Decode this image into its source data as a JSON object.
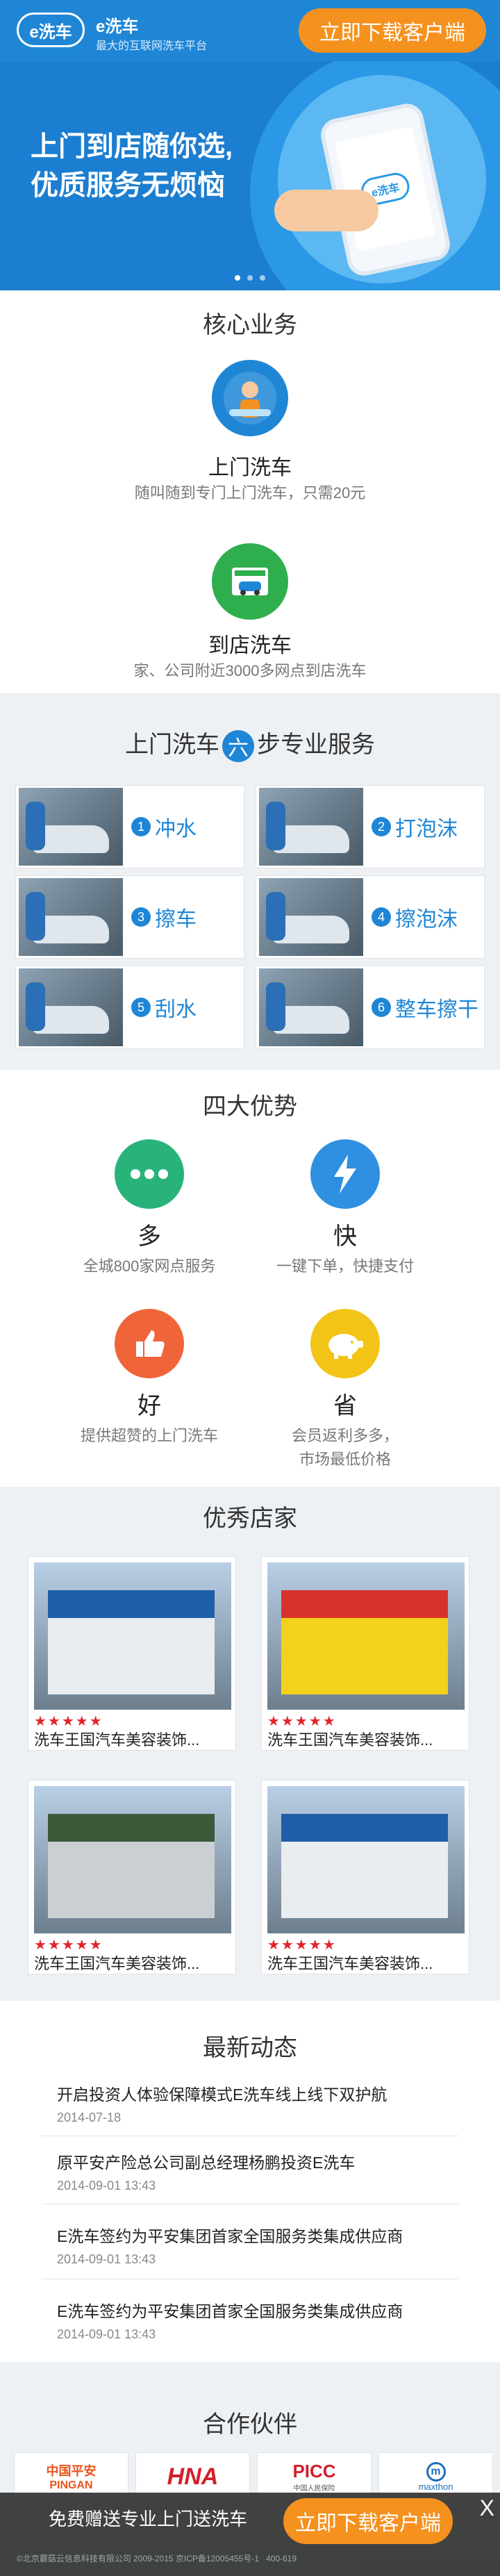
{
  "header": {
    "logo_text": "e洗车",
    "brand": "e洗车",
    "tagline": "最大的互联网洗车平台",
    "download": "立即下载客户端"
  },
  "banner": {
    "line1": "上门到店随你选,",
    "line2": "优质服务无烦恼",
    "phone_logo": "e洗车"
  },
  "core": {
    "title": "核心业务",
    "items": [
      {
        "name": "上门洗车",
        "desc": "随叫随到专门上门洗车，只需20元"
      },
      {
        "name": "到店洗车",
        "desc": "家、公司附近3000多网点到店洗车"
      }
    ]
  },
  "steps": {
    "title_pre": "上门洗车",
    "title_num": "六",
    "title_post": "步专业服务",
    "items": [
      {
        "num": "1",
        "label": "冲水"
      },
      {
        "num": "2",
        "label": "打泡沫"
      },
      {
        "num": "3",
        "label": "擦车"
      },
      {
        "num": "4",
        "label": "擦泡沫"
      },
      {
        "num": "5",
        "label": "刮水"
      },
      {
        "num": "6",
        "label": "整车擦干"
      }
    ]
  },
  "advantages": {
    "title": "四大优势",
    "items": [
      {
        "name": "多",
        "desc1": "全城800家网点服务",
        "desc2": "",
        "color": "#28b37a"
      },
      {
        "name": "快",
        "desc1": "一键下单，快捷支付",
        "desc2": "",
        "color": "#2f8fe0"
      },
      {
        "name": "好",
        "desc1": "提供超赞的上门洗车",
        "desc2": "",
        "color": "#f0643a"
      },
      {
        "name": "省",
        "desc1": "会员返利多多，",
        "desc2": "市场最低价格",
        "color": "#f2c418"
      }
    ]
  },
  "stores": {
    "title": "优秀店家",
    "items": [
      {
        "name": "洗车王国汽车美容装饰...",
        "stars": "★★★★★"
      },
      {
        "name": "洗车王国汽车美容装饰...",
        "stars": "★★★★★"
      },
      {
        "name": "洗车王国汽车美容装饰...",
        "stars": "★★★★★"
      },
      {
        "name": "洗车王国汽车美容装饰...",
        "stars": "★★★★★"
      }
    ]
  },
  "news": {
    "title": "最新动态",
    "items": [
      {
        "title": "开启投资人体验保障模式E洗车线上线下双护航",
        "date": "2014-07-18"
      },
      {
        "title": "原平安产险总公司副总经理杨鹏投资E洗车",
        "date": "2014-09-01 13:43"
      },
      {
        "title": "E洗车签约为平安集团首家全国服务类集成供应商",
        "date": "2014-09-01 13:43"
      },
      {
        "title": "E洗车签约为平安集团首家全国服务类集成供应商",
        "date": "2014-09-01 13:43"
      }
    ]
  },
  "partners": {
    "title": "合作伙伴",
    "items": [
      {
        "name": "中国平安",
        "sub": "PINGAN",
        "color": "#e8541c"
      },
      {
        "name": "HNA",
        "sub": "",
        "color": "#d3202a"
      },
      {
        "name": "PICC",
        "sub": "中国人民保险",
        "color": "#d3202a"
      },
      {
        "name": "m",
        "sub": "maxthon",
        "color": "#1f6fb8"
      }
    ]
  },
  "bottom_bar": {
    "text": "免费赠送专业上门送洗车",
    "download": "立即下载客户端",
    "close": "X",
    "copyright": "©北京蘑菇云信息科技有限公司 2009-2015 京ICP备12005455号-1",
    "phone": "400-619"
  }
}
